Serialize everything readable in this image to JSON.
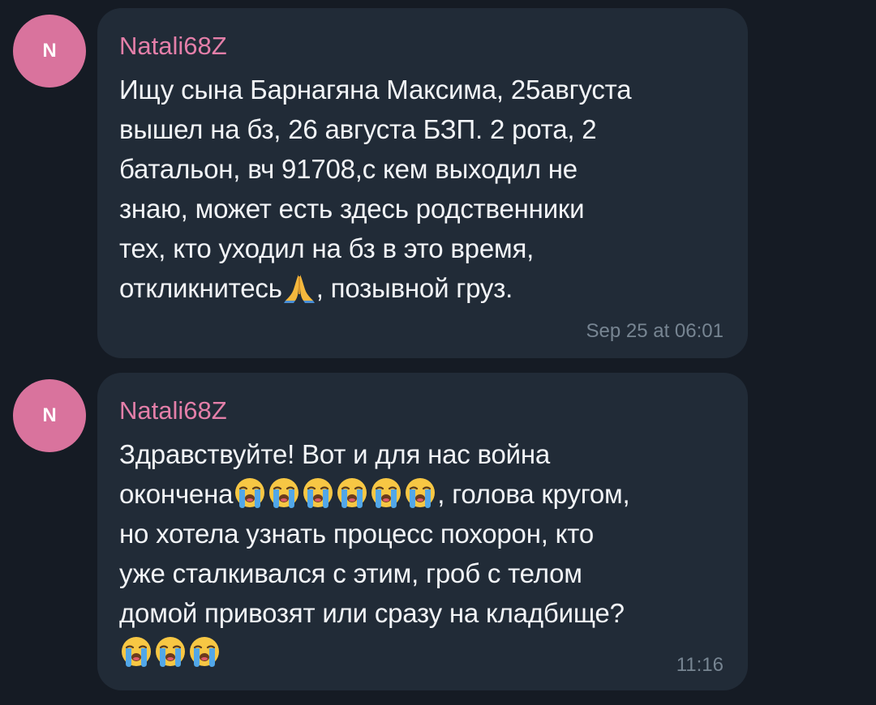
{
  "messages": [
    {
      "avatar_initial": "N",
      "sender": "Natali68Z",
      "lines": [
        "Ищу сына Барнагяна Максима, 25августа",
        "вышел на бз, 26 августа БЗП. 2 рота, 2",
        "батальон, вч 91708,с кем выходил не",
        "знаю, может есть здесь родственники",
        "тех, кто уходил на бз в это время,"
      ],
      "last_line_before_emoji": "откликнитесь",
      "last_line_after_emoji": ", позывной груз.",
      "timestamp": "Sep 25 at 06:01",
      "emoji": "folded-hands"
    },
    {
      "avatar_initial": "N",
      "sender": "Natali68Z",
      "line1": "Здравствуйте! Вот и для нас война",
      "line2_before": "окончена",
      "line2_after": ", голова кругом,",
      "lines_rest": [
        "но хотела узнать процесс похорон, кто",
        "уже сталкивался с этим, гроб с телом",
        "домой привозят или сразу на кладбище?"
      ],
      "timestamp": "11:16",
      "emoji": "loudly-crying-face"
    }
  ],
  "colors": {
    "background": "#151b24",
    "bubble": "#212b37",
    "avatar": "#d9739d",
    "sender": "#e47fa9",
    "text": "#f2f4f7",
    "timestamp": "#778592"
  }
}
